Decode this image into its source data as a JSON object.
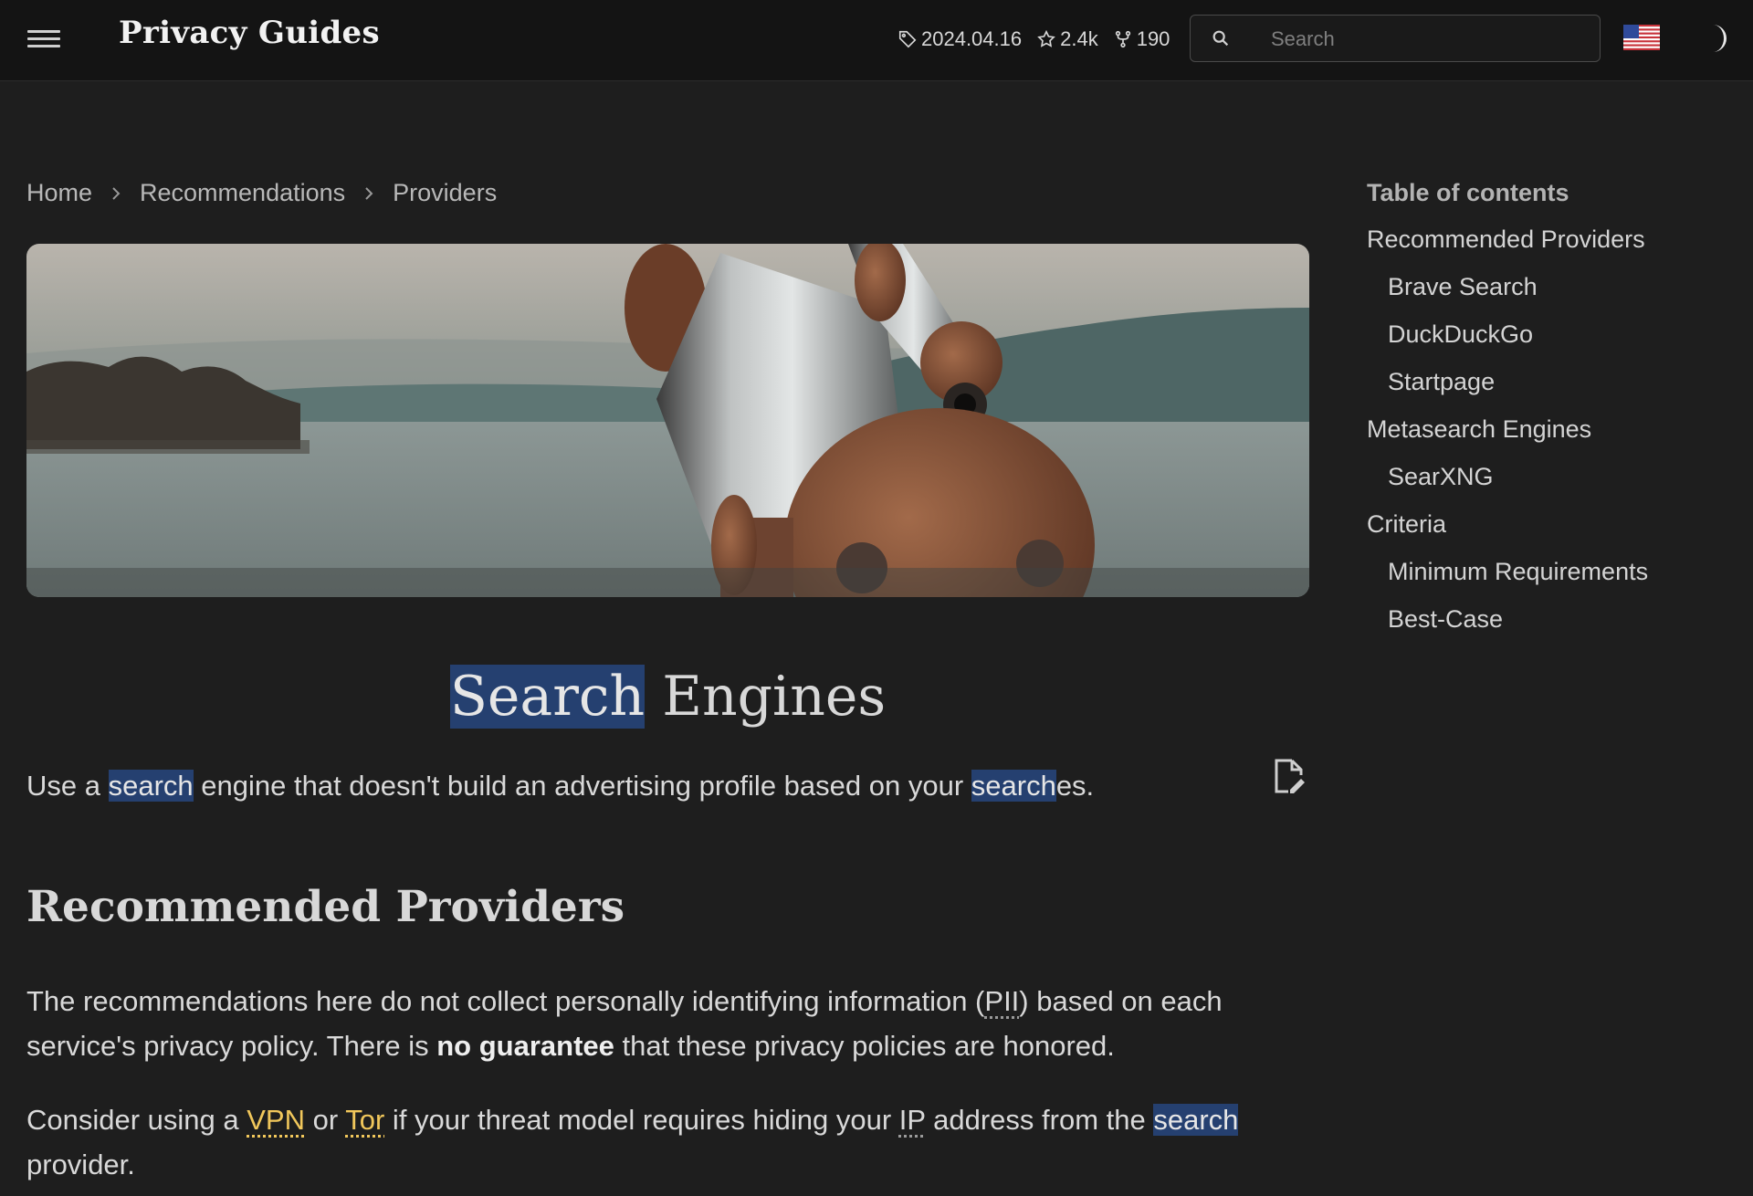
{
  "header": {
    "site_title": "Privacy Guides",
    "version": "2024.04.16",
    "stars": "2.4k",
    "forks": "190",
    "search_placeholder": "Search",
    "language_flag": "flag-us-icon",
    "theme_toggle_icon": "half-moon-icon"
  },
  "breadcrumb": [
    "Home",
    "Recommendations",
    "Providers"
  ],
  "page": {
    "title_highlight": "Search",
    "title_rest": " Engines",
    "intro": {
      "part1": "Use a ",
      "hl1": "search",
      "part2": " engine that doesn't build an advertising profile based on your ",
      "hl2": "search",
      "part3": "es."
    },
    "section_heading": "Recommended Providers",
    "para1": {
      "a": "The recommendations here do not collect personally identifying information (",
      "abbr": "PII",
      "b": ") based on each service's privacy policy. There is ",
      "strong": "no guarantee",
      "c": " that these privacy policies are honored."
    },
    "para2": {
      "a": "Consider using a ",
      "link1": "VPN",
      "b": " or ",
      "link2": "Tor",
      "c": " if your threat model requires hiding your ",
      "abbr": "IP",
      "d": " address from the ",
      "hl": "search",
      "e": " provider."
    }
  },
  "toc": {
    "title": "Table of contents",
    "items": [
      {
        "label": "Recommended Providers",
        "level": 1
      },
      {
        "label": "Brave Search",
        "level": 2
      },
      {
        "label": "DuckDuckGo",
        "level": 2
      },
      {
        "label": "Startpage",
        "level": 2
      },
      {
        "label": "Metasearch Engines",
        "level": 1
      },
      {
        "label": "SearXNG",
        "level": 2
      },
      {
        "label": "Criteria",
        "level": 1
      },
      {
        "label": "Minimum Requirements",
        "level": 2
      },
      {
        "label": "Best-Case",
        "level": 2
      }
    ]
  },
  "colors": {
    "background": "#1e1e1e",
    "header_bg": "#141414",
    "search_highlight": "#254070",
    "link": "#f1c75b"
  }
}
